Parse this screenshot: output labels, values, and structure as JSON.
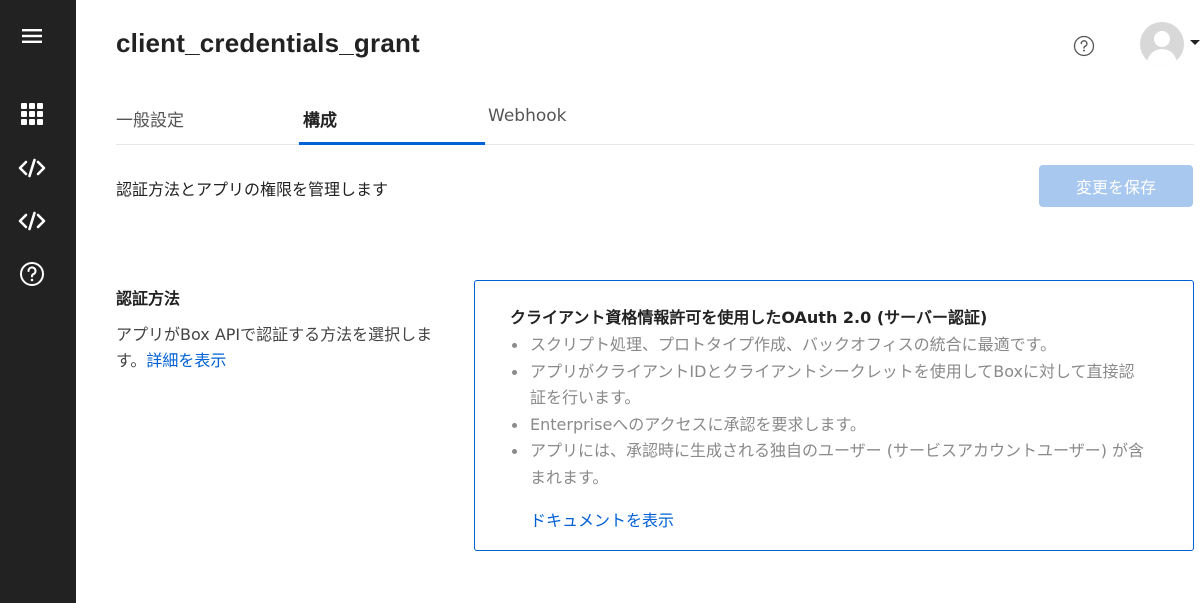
{
  "app": {
    "title": "client_credentials_grant"
  },
  "sidebar": {
    "items": [
      {
        "icon": "menu-icon"
      },
      {
        "icon": "grid-icon"
      },
      {
        "icon": "code-icon"
      },
      {
        "icon": "code-icon"
      },
      {
        "icon": "help-icon"
      }
    ],
    "color": "#222222"
  },
  "header": {
    "help_icon": "help-icon",
    "avatar_icon": "user-avatar"
  },
  "tabs": [
    {
      "label": "一般設定",
      "active": false
    },
    {
      "label": "構成",
      "active": true
    },
    {
      "label": "Webhook",
      "active": false
    }
  ],
  "main": {
    "subtitle": "認証方法とアプリの権限を管理します",
    "save_label": "変更を保存",
    "auth_section": {
      "title": "認証方法",
      "description": "アプリがBox APIで認証する方法を選択します。",
      "details_link": "詳細を表示"
    },
    "auth_card": {
      "title": "クライアント資格情報許可を使用したOAuth 2.0 (サーバー認証)",
      "bullets": [
        "スクリプト処理、プロトタイプ作成、バックオフィスの統合に最適です。",
        "アプリがクライアントIDとクライアントシークレットを使用してBoxに対して直接認証を行います。",
        "Enterpriseへのアクセスに承認を要求します。",
        "アプリには、承認時に生成される独自のユーザー (サービスアカウントユーザー) が含まれます。"
      ],
      "doc_link": "ドキュメントを表示",
      "selected": true
    }
  },
  "colors": {
    "accent": "#0061d5",
    "save_button_disabled": "#a8c8f0",
    "sidebar_bg": "#222222"
  }
}
